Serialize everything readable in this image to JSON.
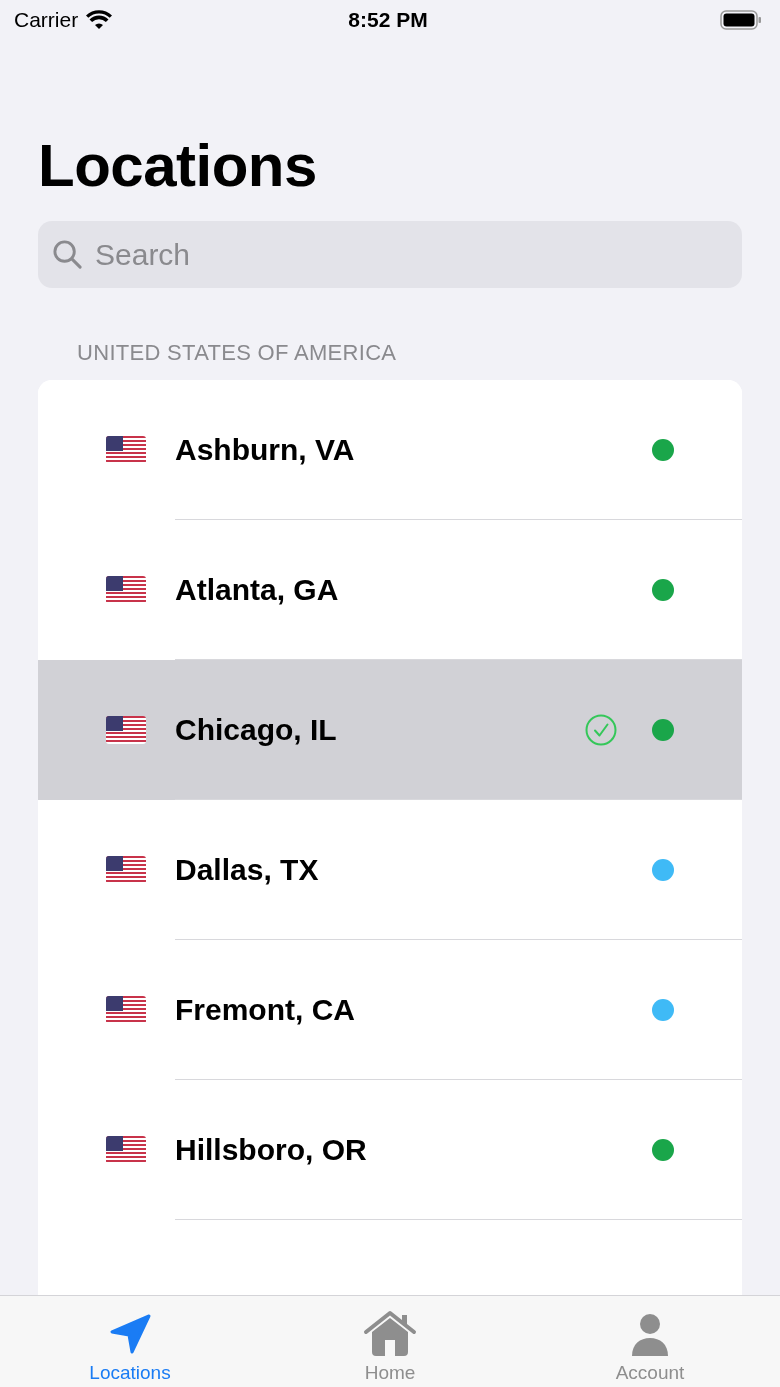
{
  "status_bar": {
    "carrier": "Carrier",
    "time": "8:52 PM"
  },
  "title": "Locations",
  "search": {
    "placeholder": "Search"
  },
  "section": {
    "header": "UNITED STATES OF AMERICA",
    "rows": [
      {
        "name": "Ashburn, VA",
        "selected": false,
        "color": "#1aa64a"
      },
      {
        "name": "Atlanta, GA",
        "selected": false,
        "color": "#1aa64a"
      },
      {
        "name": "Chicago, IL",
        "selected": true,
        "color": "#1aa64a"
      },
      {
        "name": "Dallas, TX",
        "selected": false,
        "color": "#3fbaf6"
      },
      {
        "name": "Fremont, CA",
        "selected": false,
        "color": "#3fbaf6"
      },
      {
        "name": "Hillsboro, OR",
        "selected": false,
        "color": "#1aa64a"
      }
    ]
  },
  "tabs": [
    {
      "kind": "locations",
      "label": "Locations",
      "selected": true
    },
    {
      "kind": "home",
      "label": "Home",
      "selected": false
    },
    {
      "kind": "account",
      "label": "Account",
      "selected": false
    }
  ]
}
